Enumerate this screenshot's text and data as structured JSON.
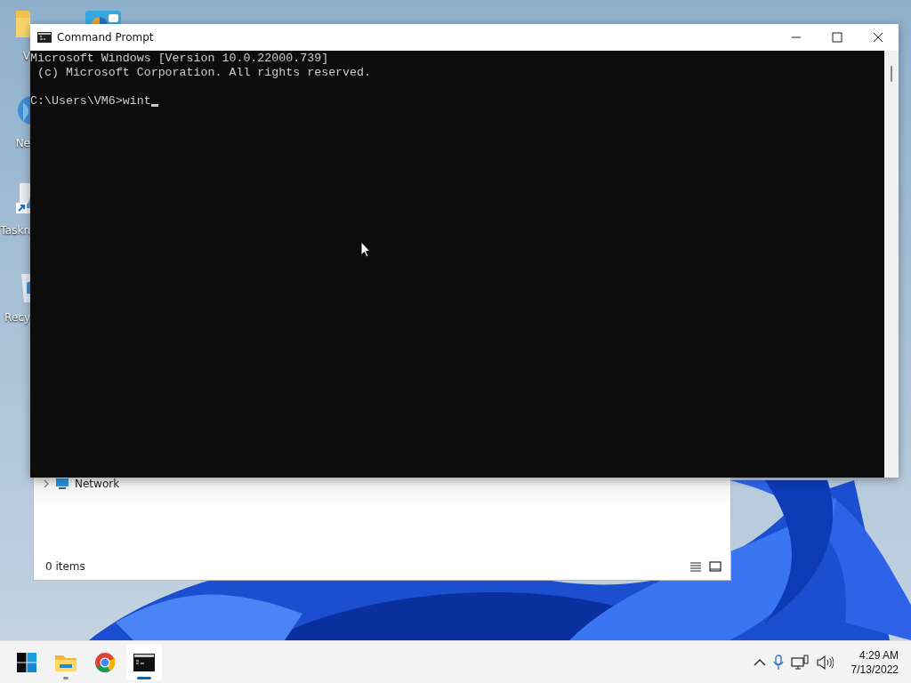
{
  "desktop": {
    "icons": [
      {
        "kind": "folder",
        "label": "V"
      },
      {
        "kind": "globe",
        "label": "Ne"
      },
      {
        "kind": "shortcut",
        "label": "Taskn"
      },
      {
        "kind": "bin",
        "label": "Recy"
      },
      {
        "kind": "panel"
      }
    ]
  },
  "explorer": {
    "nav_items": [
      {
        "label": "Network",
        "expanded": false
      }
    ],
    "status": "0 items",
    "views": [
      {
        "kind": "details",
        "selected": false
      },
      {
        "kind": "tiles",
        "selected": false
      }
    ]
  },
  "console_window": {
    "title": "Command Prompt",
    "output": [
      "Microsoft Windows [Version 10.0.22000.739]",
      " (c) Microsoft Corporation. All rights reserved."
    ],
    "prompt": "C:\\Users\\VM6>wint",
    "cursor_visible": true
  },
  "taskbar": {
    "apps": [
      {
        "kind": "start",
        "running": false,
        "active": false
      },
      {
        "kind": "explorer",
        "running": true,
        "active": false
      },
      {
        "kind": "chrome",
        "running": false,
        "active": false
      },
      {
        "kind": "cmd",
        "running": true,
        "active": true
      }
    ],
    "tray": {
      "time": "4:29 AM",
      "date": "7/13/2022"
    }
  }
}
